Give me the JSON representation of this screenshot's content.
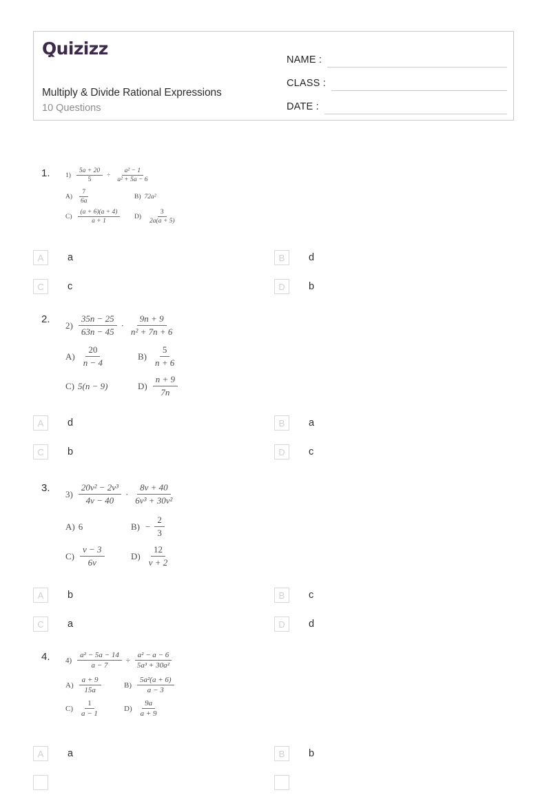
{
  "header": {
    "logo_text": "Quizizz",
    "logo_color": "#3c2a4d",
    "quiz_title": "Multiply & Divide Rational Expressions",
    "question_count_label": "10 Questions",
    "fields": [
      {
        "label": "NAME :",
        "value": ""
      },
      {
        "label": "CLASS :",
        "value": ""
      },
      {
        "label": "DATE  :",
        "value": ""
      }
    ]
  },
  "questions": [
    {
      "number": "1.",
      "problem_tag": "1)",
      "expression": {
        "left_num": "5a + 20",
        "left_den": "5",
        "operator": "÷",
        "right_num": "a² − 1",
        "right_den": "a² + 5a − 6"
      },
      "choices": [
        {
          "tag": "A)",
          "num": "7",
          "den": "6a"
        },
        {
          "tag": "B)",
          "whole": "72a²"
        },
        {
          "tag": "C)",
          "num": "(a + 6)(a + 4)",
          "den": "a + 1"
        },
        {
          "tag": "D)",
          "num": "3",
          "den": "2a(a + 5)"
        }
      ],
      "answers": [
        {
          "letter": "A",
          "text": "a"
        },
        {
          "letter": "B",
          "text": "d"
        },
        {
          "letter": "C",
          "text": "c"
        },
        {
          "letter": "D",
          "text": "b"
        }
      ]
    },
    {
      "number": "2.",
      "problem_tag": "2)",
      "expression": {
        "left_num": "35n − 25",
        "left_den": "63n − 45",
        "operator": "·",
        "right_num": "9n + 9",
        "right_den": "n² + 7n + 6"
      },
      "choices": [
        {
          "tag": "A)",
          "num": "20",
          "den": "n − 4"
        },
        {
          "tag": "B)",
          "num": "5",
          "den": "n + 6"
        },
        {
          "tag": "C)",
          "whole": "5(n − 9)"
        },
        {
          "tag": "D)",
          "num": "n + 9",
          "den": "7n"
        }
      ],
      "answers": [
        {
          "letter": "A",
          "text": "d"
        },
        {
          "letter": "B",
          "text": "a"
        },
        {
          "letter": "C",
          "text": "b"
        },
        {
          "letter": "D",
          "text": "c"
        }
      ]
    },
    {
      "number": "3.",
      "problem_tag": "3)",
      "expression": {
        "left_num": "20v² − 2v³",
        "left_den": "4v − 40",
        "operator": "·",
        "right_num": "8v + 40",
        "right_den": "6v³ + 30v²"
      },
      "choices": [
        {
          "tag": "A)",
          "whole": "6"
        },
        {
          "tag": "B)",
          "sign": "−",
          "num": "2",
          "den": "3"
        },
        {
          "tag": "C)",
          "num": "v − 3",
          "den": "6v"
        },
        {
          "tag": "D)",
          "num": "12",
          "den": "v + 2"
        }
      ],
      "answers": [
        {
          "letter": "A",
          "text": "b"
        },
        {
          "letter": "B",
          "text": "c"
        },
        {
          "letter": "C",
          "text": "a"
        },
        {
          "letter": "D",
          "text": "d"
        }
      ]
    },
    {
      "number": "4.",
      "problem_tag": "4)",
      "expression": {
        "left_num": "a² − 5a − 14",
        "left_den": "a − 7",
        "operator": "÷",
        "right_num": "a² − a − 6",
        "right_den": "5a³ + 30a²"
      },
      "choices": [
        {
          "tag": "A)",
          "num": "a + 9",
          "den": "15a"
        },
        {
          "tag": "B)",
          "num": "5a²(a + 6)",
          "den": "a − 3"
        },
        {
          "tag": "C)",
          "num": "1",
          "den": "a − 1"
        },
        {
          "tag": "D)",
          "num": "9a",
          "den": "a + 9"
        }
      ],
      "answers": [
        {
          "letter": "A",
          "text": "a"
        },
        {
          "letter": "B",
          "text": "b"
        }
      ]
    }
  ]
}
